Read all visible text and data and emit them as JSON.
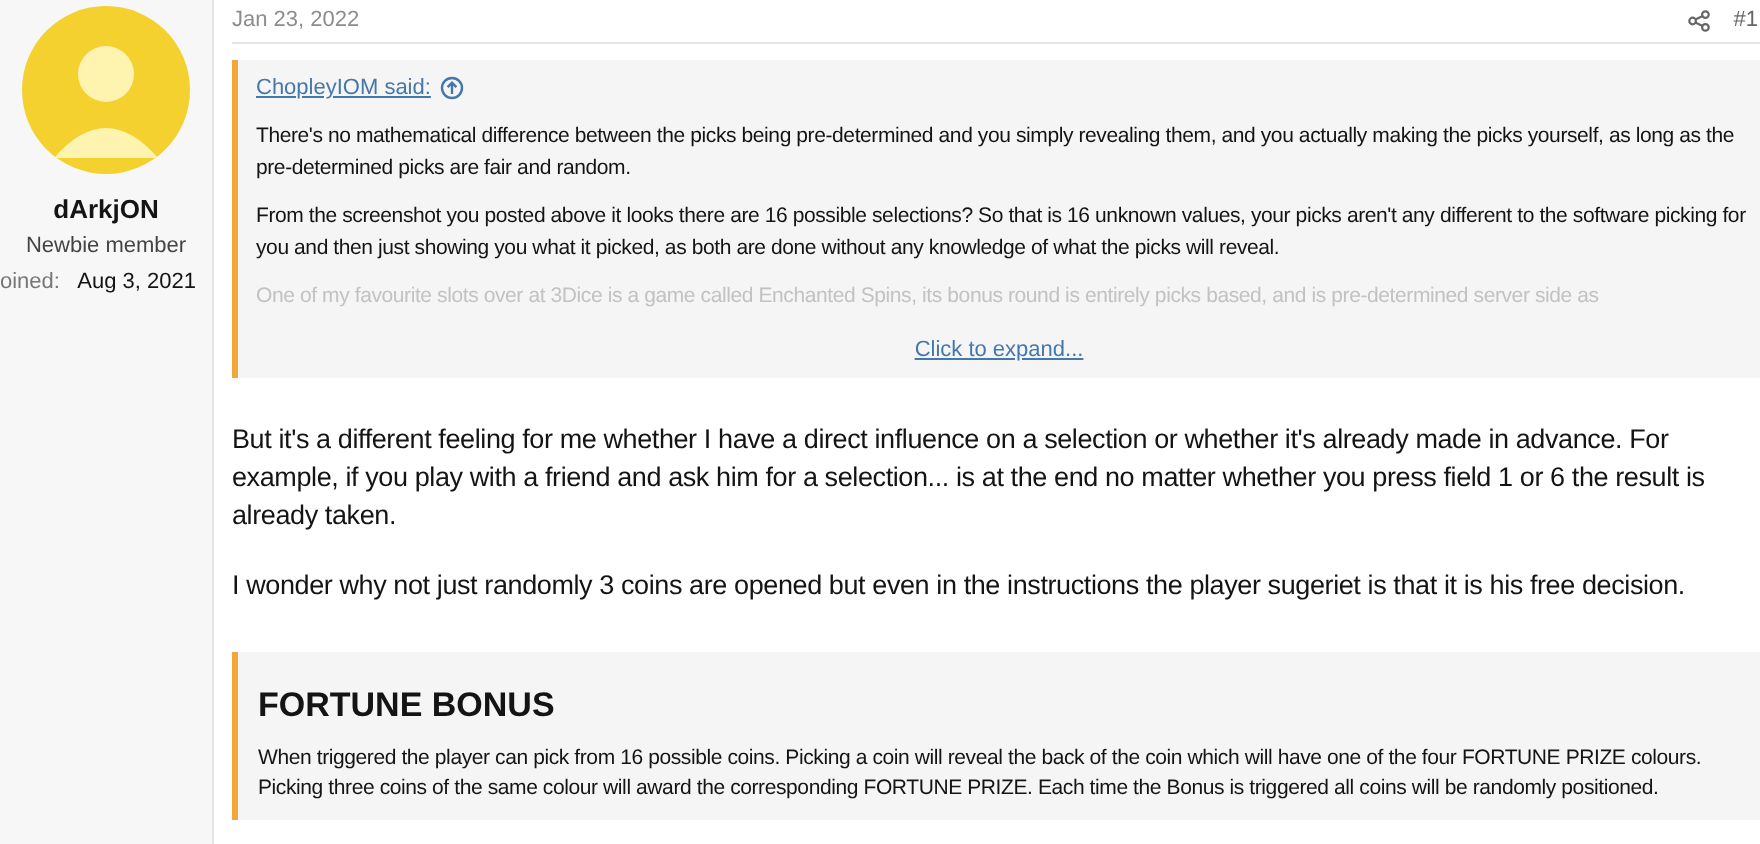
{
  "user": {
    "name": "dArkjON",
    "title": "Newbie member",
    "joined_label": "oined:",
    "joined_date": "Aug 3, 2021"
  },
  "post": {
    "date": "Jan 23, 2022",
    "number": "#1"
  },
  "quote": {
    "author": "ChopleyIOM said:",
    "paragraphs": [
      "There's no mathematical difference between the picks being pre-determined and you simply revealing them, and you actually making the picks yourself, as long as the pre-determined picks are fair and random.",
      "From the screenshot you posted above it looks there are 16 possible selections? So that is 16 unknown values, your picks aren't any different to the software picking for you and then just showing you what it picked, as both are done without any knowledge of what the picks will reveal.",
      "One of my favourite slots over at 3Dice is a game called Enchanted Spins, its bonus round is entirely picks based, and is pre-determined server side as"
    ],
    "expand": "Click to expand..."
  },
  "body": [
    "But it's a different feeling for me whether I have a direct influence on a selection or whether it's already made in advance. For example, if you play with a friend and ask him for a selection... is at the end no matter whether you press field 1 or 6 the result is already taken.",
    "I wonder why not just randomly 3 coins are opened but even in the instructions the player sugeriet is that it is his free decision."
  ],
  "quote2": {
    "heading": "FORTUNE BONUS",
    "text": "When triggered the player can pick from 16 possible coins. Picking a coin will reveal the back of the coin which will have one of the four FORTUNE PRIZE colours. Picking three coins of the same colour will award the corresponding FORTUNE PRIZE. Each time the Bonus is triggered all coins will be randomly positioned."
  }
}
